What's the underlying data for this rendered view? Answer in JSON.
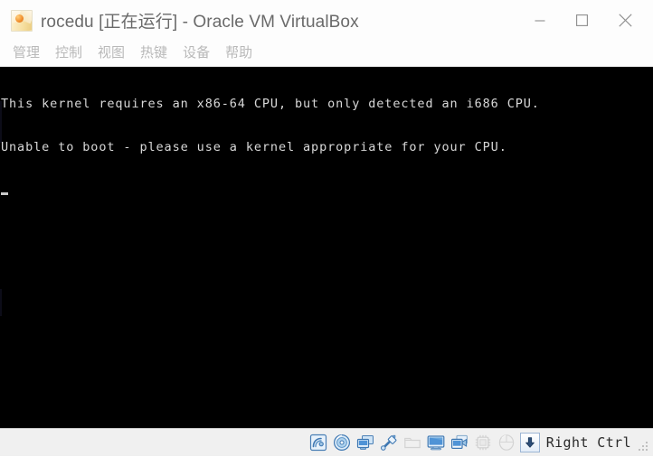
{
  "window": {
    "title": "rocedu [正在运行] - Oracle VM VirtualBox",
    "app_icon": "virtualbox-icon",
    "controls": {
      "minimize_label": "最小化",
      "maximize_label": "最大化",
      "close_label": "关闭"
    }
  },
  "menubar": {
    "items": [
      {
        "label": "管理",
        "name": "menu-item-manage"
      },
      {
        "label": "控制",
        "name": "menu-item-machine"
      },
      {
        "label": "视图",
        "name": "menu-item-view"
      },
      {
        "label": "热键",
        "name": "menu-item-input"
      },
      {
        "label": "设备",
        "name": "menu-item-devices"
      },
      {
        "label": "帮助",
        "name": "menu-item-help"
      }
    ]
  },
  "vm_screen": {
    "background_color": "#000000",
    "text_color": "#d8d8d8",
    "console_lines": [
      "This kernel requires an x86-64 CPU, but only detected an i686 CPU.",
      "Unable to boot - please use a kernel appropriate for your CPU."
    ],
    "cursor": "block-cursor"
  },
  "statusbar": {
    "background_color": "#f0f0f0",
    "icons": [
      {
        "name": "hard-disk-icon",
        "title": "硬盘",
        "disabled": false
      },
      {
        "name": "optical-disc-icon",
        "title": "分配光驱",
        "disabled": false
      },
      {
        "name": "network-icon",
        "title": "网络",
        "disabled": false
      },
      {
        "name": "usb-icon",
        "title": "USB 设备",
        "disabled": false
      },
      {
        "name": "shared-folder-icon",
        "title": "共享文件夹",
        "disabled": true
      },
      {
        "name": "display-icon",
        "title": "显示",
        "disabled": false
      },
      {
        "name": "video-capture-icon",
        "title": "录像",
        "disabled": false
      },
      {
        "name": "cpu-chip-icon",
        "title": "处理器",
        "disabled": true
      },
      {
        "name": "mouse-icon",
        "title": "鼠标集成",
        "disabled": true
      }
    ],
    "host_key_button": {
      "name": "host-key-button",
      "icon": "down-arrow-icon"
    },
    "host_key_label": "Right Ctrl",
    "resize_grip": "resize-grip-icon"
  }
}
